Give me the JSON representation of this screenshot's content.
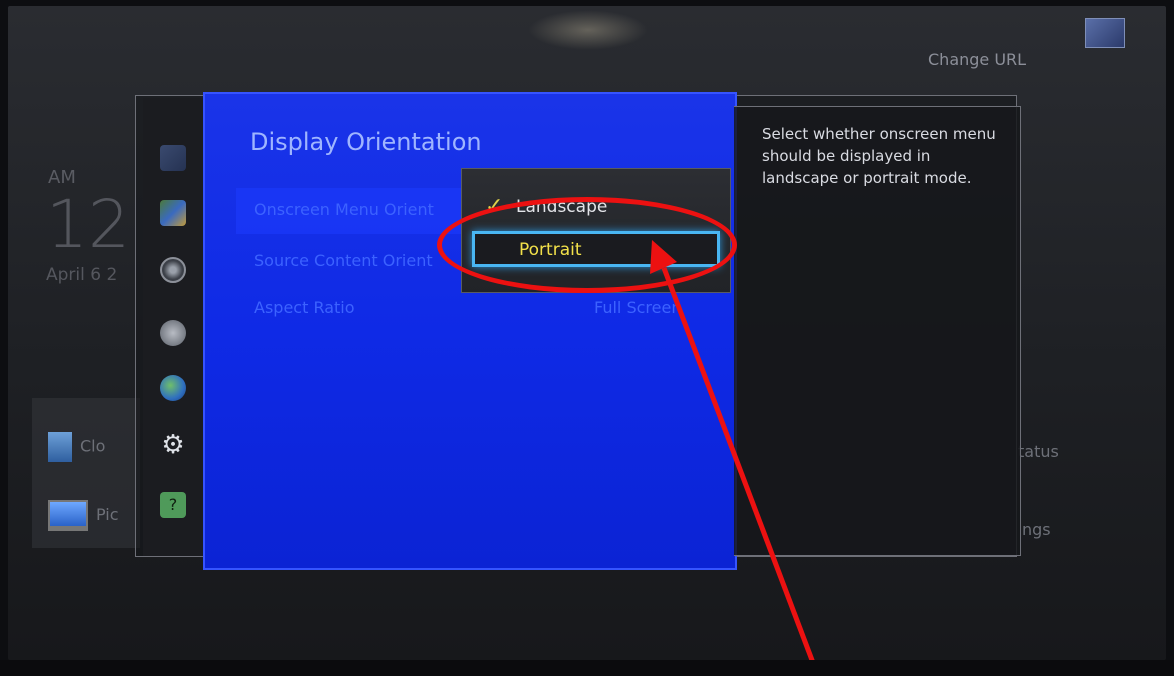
{
  "background": {
    "change_url": "Change URL",
    "home": {
      "am_label": "AM",
      "time": "12",
      "date": "April 6 2",
      "rows": [
        {
          "label": "Clo",
          "icon": "cloud-app-icon"
        },
        {
          "label": "Pic",
          "icon": "monitor-icon"
        }
      ],
      "right_labels": [
        "tatus",
        "ngs"
      ]
    }
  },
  "menu": {
    "title": "Display Orientation",
    "items": [
      {
        "label": "Onscreen Menu Orient"
      },
      {
        "label": "Source Content Orient"
      },
      {
        "label": "Aspect Ratio",
        "value": "Full Screen"
      }
    ],
    "popup": {
      "options": [
        {
          "label": "Landscape",
          "checked": true
        },
        {
          "label": "Portrait",
          "focused": true
        }
      ]
    },
    "help_text": "Select whether onscreen menu should be displayed in landscape or portrait mode."
  },
  "side_icons": [
    "picture-icon",
    "photo-icon",
    "sound-icon",
    "network-icon",
    "globe-icon",
    "gear-icon",
    "help-icon"
  ],
  "colors": {
    "menu_blue": "#0f2ae6",
    "focus_border": "#49b6f2",
    "portrait_text": "#f2e14a",
    "annotation_red": "#ec1111"
  }
}
